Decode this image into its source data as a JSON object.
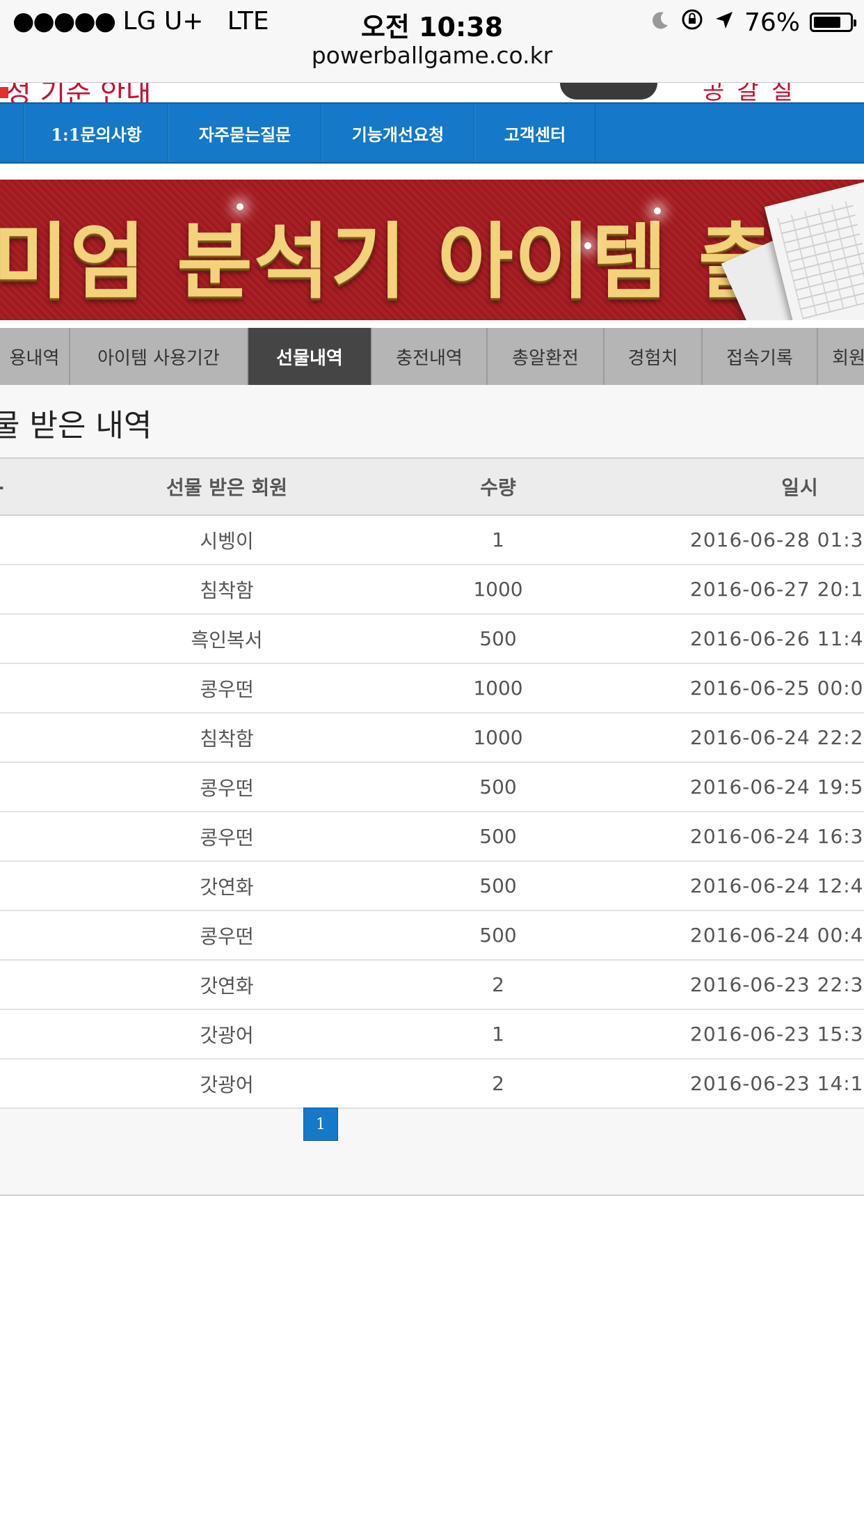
{
  "status_bar": {
    "signal": "●●●●●",
    "carrier": "LG U+",
    "network": "LTE",
    "time": "오전 10:38",
    "battery": "76%",
    "battery_level": 0.76,
    "url": "powerballgame.co.kr"
  },
  "header": {
    "notice_text": "성 기준 안내",
    "right_text": "공갈칠",
    "nav": [
      "1:1문의사항",
      "자주묻는질문",
      "기능개선요청",
      "고객센터"
    ]
  },
  "banner": {
    "text": "미엄 분석기 아이템 출시!!"
  },
  "tabs": {
    "items": [
      "용내역",
      "아이템 사용기간",
      "선물내역",
      "충전내역",
      "총알환전",
      "경험치",
      "접속기록",
      "회원"
    ],
    "active_index": 2
  },
  "section": {
    "title": "물 받은 내역"
  },
  "table": {
    "headers": [
      "-",
      "선물 받은 회원",
      "수량",
      "일시"
    ],
    "rows": [
      {
        "member": "시벵이",
        "qty": "1",
        "date": "2016-06-28 01:3"
      },
      {
        "member": "침착함",
        "qty": "1000",
        "date": "2016-06-27 20:1"
      },
      {
        "member": "흑인복서",
        "qty": "500",
        "date": "2016-06-26 11:4"
      },
      {
        "member": "콩우떤",
        "qty": "1000",
        "date": "2016-06-25 00:0"
      },
      {
        "member": "침착함",
        "qty": "1000",
        "date": "2016-06-24 22:2"
      },
      {
        "member": "콩우떤",
        "qty": "500",
        "date": "2016-06-24 19:5"
      },
      {
        "member": "콩우떤",
        "qty": "500",
        "date": "2016-06-24 16:3"
      },
      {
        "member": "갓연화",
        "qty": "500",
        "date": "2016-06-24 12:4"
      },
      {
        "member": "콩우떤",
        "qty": "500",
        "date": "2016-06-24 00:4"
      },
      {
        "member": "갓연화",
        "qty": "2",
        "date": "2016-06-23 22:3"
      },
      {
        "member": "갓광어",
        "qty": "1",
        "date": "2016-06-23 15:3"
      },
      {
        "member": "갓광어",
        "qty": "2",
        "date": "2016-06-23 14:1"
      }
    ]
  },
  "pagination": {
    "current": "1"
  },
  "colors": {
    "nav_blue": "#1578c9",
    "banner_red": "#a82127",
    "tab_active": "#454545",
    "notice_red": "#c8102e"
  }
}
